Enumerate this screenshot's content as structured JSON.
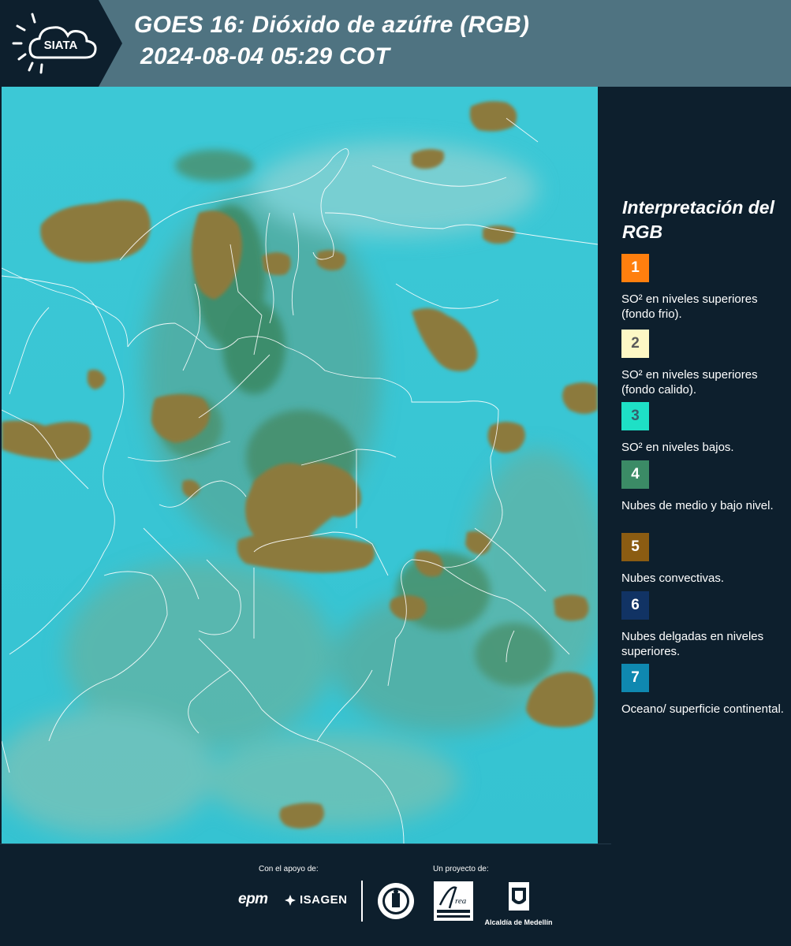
{
  "header": {
    "logo_text": "SIATA",
    "title": "GOES 16: Dióxido de azúfre (RGB)",
    "datetime": "2024-08-04 05:29 COT"
  },
  "colors": {
    "header_bg": "#4f7381",
    "panel_bg": "#0d1f2d",
    "ocean": "#3fc9d6",
    "convective": "#8c7a3d",
    "midlevel": "#3f8c6b"
  },
  "legend": {
    "title": "Interpretación del RGB",
    "items": [
      {
        "number": "1",
        "color": "#ff7f0e",
        "text_color": "#ffffff",
        "label": "SO² en niveles superiores (fondo frio)."
      },
      {
        "number": "2",
        "color": "#fdf8c5",
        "text_color": "#5a5a5a",
        "label": "SO² en niveles superiores (fondo calido)."
      },
      {
        "number": "3",
        "color": "#1ee0c6",
        "text_color": "#35606c",
        "label": "SO² en niveles bajos."
      },
      {
        "number": "4",
        "color": "#3b8b66",
        "text_color": "#ffffff",
        "label": "Nubes de medio y bajo nivel."
      },
      {
        "number": "5",
        "color": "#8b5c12",
        "text_color": "#ffffff",
        "label": "Nubes convectivas."
      },
      {
        "number": "6",
        "color": "#113364",
        "text_color": "#ffffff",
        "label": "Nubes delgadas en niveles superiores."
      },
      {
        "number": "7",
        "color": "#0f88b0",
        "text_color": "#ffffff",
        "label": "Oceano/ superficie continental."
      }
    ]
  },
  "footer": {
    "support_label": "Con el apoyo de:",
    "project_label": "Un proyecto de:",
    "sponsors": [
      "epm",
      "ISAGEN"
    ],
    "partners": [
      "Área Metropolitana Valle de Aburrá",
      "Alcaldía de Medellín"
    ],
    "alcaldia_text": "Alcaldía de Medellín"
  }
}
